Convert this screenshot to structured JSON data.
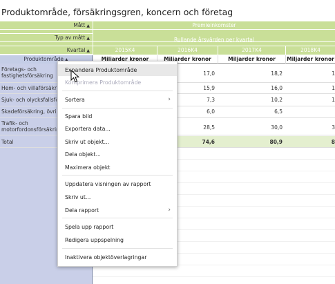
{
  "title": "Produktområde, försäkringsgren, koncern och företag",
  "header": {
    "matt_label": "Mått",
    "typ_label": "Typ av mått",
    "kvartal_label": "Kvartal",
    "sort_glyph": "▲",
    "matt_value": "Premieinkomster",
    "typ_value": "Rullande årsvärden per kvartal",
    "quarters": [
      "2015K4",
      "2016K4",
      "2017K4",
      "2018K4"
    ],
    "row_dimension": "Produktområde",
    "unit": "Miljarder kronor"
  },
  "rows": [
    {
      "label": "Företags- och fastighetsförsäkring",
      "v2016": "17,0",
      "v2017": "18,2",
      "v2018": "1"
    },
    {
      "label": "Hem- och villaförsäkring",
      "v2016": "15,9",
      "v2017": "16,0",
      "v2018": "1"
    },
    {
      "label": "Sjuk- och olycksfallsförsäkring",
      "v2016": "7,3",
      "v2017": "10,2",
      "v2018": "1"
    },
    {
      "label": "Skadeförsäkring, övrig",
      "v2016": "6,0",
      "v2017": "6,5",
      "v2018": ""
    },
    {
      "label": "Trafik- och motorfordonsförsäkring",
      "v2016": "28,5",
      "v2017": "30,0",
      "v2018": "3"
    },
    {
      "label": "Total",
      "v2016": "74,6",
      "v2017": "80,9",
      "v2018": "8"
    }
  ],
  "menu": {
    "items": [
      {
        "label": "Expandera Produktområde",
        "state": "hover"
      },
      {
        "label": "Komprimera Produktområde",
        "state": "disabled"
      },
      {
        "label": "Sortera",
        "submenu": true
      },
      {
        "label": "Spara bild"
      },
      {
        "label": "Exportera data..."
      },
      {
        "label": "Skriv ut objekt..."
      },
      {
        "label": "Dela objekt..."
      },
      {
        "label": "Maximera objekt"
      },
      {
        "label": "Uppdatera visningen av rapport"
      },
      {
        "label": "Skriv ut..."
      },
      {
        "label": "Dela rapport",
        "submenu": true
      },
      {
        "label": "Spela upp rapport"
      },
      {
        "label": "Redigera uppspelning"
      },
      {
        "label": "Inaktivera objektöverlagringar"
      }
    ],
    "submenu_glyph": "›"
  },
  "colors": {
    "header_green": "#c9df98",
    "row_blue": "#c9cfe8",
    "total_band": "#e4efcf"
  }
}
